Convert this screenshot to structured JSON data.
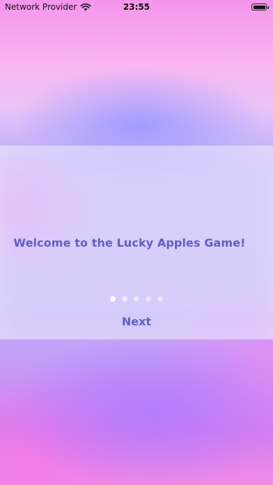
{
  "status_bar": {
    "carrier": "Network Provider",
    "time": "23:55",
    "wifi_icon": "wifi-icon",
    "battery_icon": "battery-icon"
  },
  "onboarding": {
    "message": "Welcome to the Lucky Apples Game!",
    "page_count": 5,
    "current_page": 1,
    "next_label": "Next"
  },
  "colors": {
    "accent_text": "#5e5fc8",
    "background_pink": "#f595ec",
    "background_lavender": "#c6b4f7",
    "dot_active": "#ffffff"
  }
}
